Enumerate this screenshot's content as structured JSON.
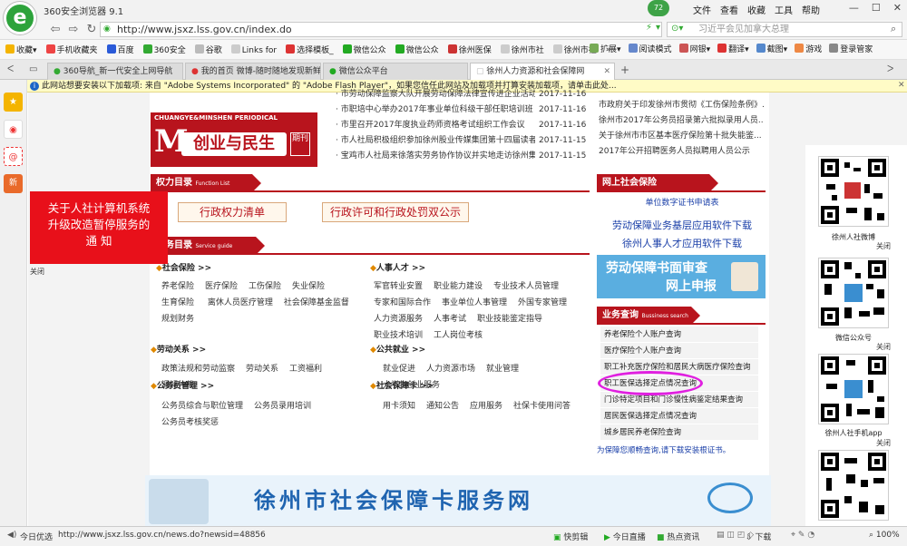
{
  "browser": {
    "title": "360安全浏览器 9.1",
    "menus": [
      "文件",
      "查看",
      "收藏",
      "工具",
      "帮助"
    ],
    "avatar_badge": "72",
    "url": "http://www.jsxz.lss.gov.cn/index.do",
    "search_placeholder": "习近平会见加拿大总理",
    "bookmarks": [
      "收藏",
      "手机收藏夹",
      "百度",
      "360安全",
      "谷歌",
      "Links for",
      "选择模板_",
      "微信公众",
      "微信公众",
      "徐州医保",
      "徐州市社",
      "徐州市社"
    ],
    "bookmarks_more": "»",
    "toolbar_right": [
      "扩展",
      "阅读模式",
      "网银",
      "翻译",
      "截图",
      "游戏",
      "登录管家"
    ],
    "tabs": [
      "360导航_新一代安全上网导航",
      "我的首页 微博-随时随地发现新鲜事",
      "微信公众平台",
      "徐州人力资源和社会保障网"
    ],
    "new_tab": "+",
    "notice": "此网站想要安装以下加载项: 来自 \"Adobe Systems Incorporated\" 的 \"Adobe Flash Player\"，如果您信任此网站及加载项并打算安装加载项，请单击此处..."
  },
  "page": {
    "news": [
      {
        "title": "市劳动保障监察大队开展劳动保障法律宣传进企业活动",
        "date": "2017-11-16"
      },
      {
        "title": "市职培中心举办2017年事业单位科级干部任职培训班",
        "date": "2017-11-16"
      },
      {
        "title": "市里召开2017年度执业药师资格考试组织工作会议",
        "date": "2017-11-16"
      },
      {
        "title": "市人社局积极组织参加徐州股业传媒集团第十四届读者节...",
        "date": "2017-11-15"
      },
      {
        "title": "宝鸡市人社局来徐落实劳务协作协议并实地走访徐州集团...",
        "date": "2017-11-15"
      }
    ],
    "magazine": {
      "letter": "M",
      "cn": "创业与民生",
      "sub": "期刊",
      "en": "CHUANGYE&MINSHEN PERIODICAL"
    },
    "notices": [
      "市政府关于印发徐州市贯彻《工伤保险条例》...",
      "徐州市2017年公务员招录第六批拟录用人员...",
      "关于徐州市市区基本医疗保险第十批失能鉴...",
      "2017年公开招聘医务人员拟聘用人员公示"
    ],
    "popup": {
      "line1": "关于人社计算机系统",
      "line2": "升级改造暂停服务的",
      "line3": "通   知",
      "close": "关闭"
    },
    "power": {
      "title": "权力目录",
      "en": "Function List",
      "btn1": "行政权力清单",
      "btn2": "行政许可和行政处罚双公示"
    },
    "service": {
      "title": "服务目录",
      "en": "Service guide"
    },
    "social_insurance": {
      "title": "社会保险 >>",
      "links": [
        "养老保险",
        "医疗保险",
        "工伤保险",
        "失业保险",
        "生育保险",
        "离休人员医疗管理",
        "社会保障基金监督",
        "规划财务"
      ]
    },
    "hr": {
      "title": "人事人才 >>",
      "links": [
        "军官转业安置",
        "职业能力建设",
        "专业技术人员管理",
        "专家和国际合作",
        "事业单位人事管理",
        "外国专家管理",
        "人力资源服务",
        "人事考试",
        "职业技能鉴定指导",
        "职业技术培训",
        "工人岗位考核"
      ]
    },
    "labor": {
      "title": "劳动关系 >>",
      "links": [
        "政策法规和劳动监察",
        "劳动关系",
        "工资福利",
        "调解仲裁"
      ]
    },
    "employment": {
      "title": "公共就业 >>",
      "links": [
        "就业促进",
        "人力资源市场",
        "就业管理",
        "大学生创业服务"
      ]
    },
    "civil": {
      "title": "公务员管理 >>",
      "links": [
        "公务员综合与职位管理",
        "公务员录用培训",
        "公务员考核奖惩"
      ]
    },
    "card": {
      "title": "社会保障卡 >>",
      "links": [
        "用卡须知",
        "通知公告",
        "应用服务",
        "社保卡使用问答"
      ]
    },
    "online": {
      "title": "网上社会保险",
      "cert": "单位数字证书申请表",
      "dl1": "劳动保障业务基层应用软件下载",
      "dl2": "徐州人事人才应用软件下载",
      "banner1": "劳动保障书面审查",
      "banner2": "网上申报"
    },
    "biz": {
      "title": "业务查询",
      "en": "Bussiness search",
      "items": [
        "养老保险个人账户查询",
        "医疗保险个人账户查询",
        "职工补充医疗保险和居民大病医疗保险查询",
        "职工医保选择定点情况查询",
        "门诊特定项目和门诊慢性病鉴定结果查询",
        "居民医保选择定点情况查询",
        "城乡居民养老保险查询"
      ],
      "tip": "为保障您顺畅查询,请下载安装根证书。"
    },
    "banner": "徐州市社会保障卡服务网",
    "right_qr": [
      {
        "label": "徐州人社微博",
        "close": "关闭"
      },
      {
        "label": "微信公众号",
        "close": "关闭"
      },
      {
        "label": "徐州人社手机app",
        "close": "关闭"
      }
    ]
  },
  "status": {
    "left": "今日优选",
    "url": "http://www.jsxz.lss.gov.cn/news.do?newsid=48856",
    "items": [
      "快剪辑",
      "今日直播",
      "热点资讯",
      "下载",
      "100%"
    ]
  },
  "colors": {
    "brand_red": "#b8141d",
    "popup_red": "#e8101a",
    "link_blue": "#1a3fa8",
    "highlight": "#e020e0",
    "green": "#2da33b"
  }
}
